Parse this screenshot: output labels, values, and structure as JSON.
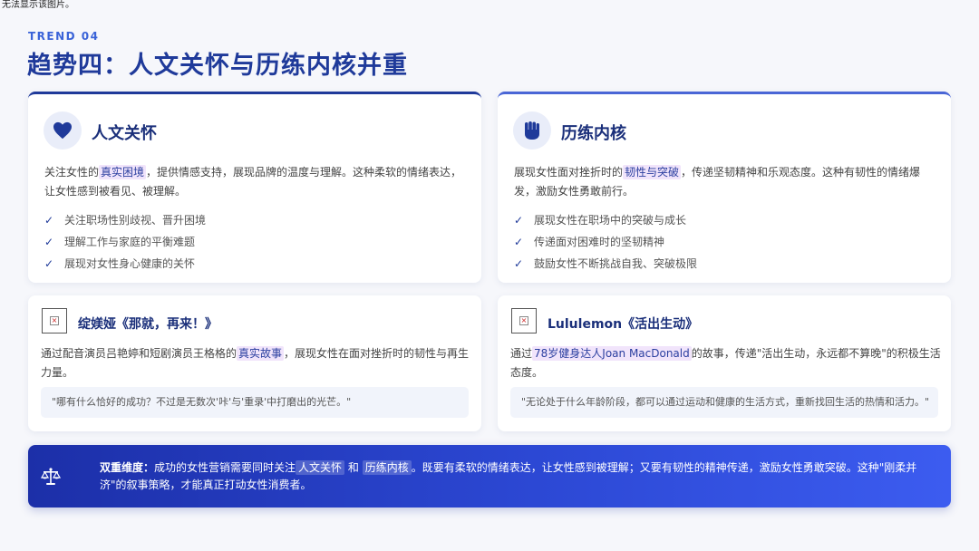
{
  "broken_image_alt": "无法显示该图片。",
  "header": {
    "trend": "TREND 04",
    "title": "趋势四：人文关怀与历练内核并重"
  },
  "cards": {
    "left": {
      "icon": "heart-icon",
      "title": "人文关怀",
      "desc_pre": "关注女性的",
      "desc_hl": "真实困境",
      "desc_post": "，提供情感支持，展现品牌的温度与理解。这种柔软的情绪表达，让女性感到被看见、被理解。",
      "items": [
        "关注职场性别歧视、晋升困境",
        "理解工作与家庭的平衡难题",
        "展现对女性身心健康的关怀"
      ]
    },
    "right": {
      "icon": "fist-icon",
      "title": "历练内核",
      "desc_pre": "展现女性面对挫折时的",
      "desc_hl": "韧性与突破",
      "desc_post": "，传递坚韧精神和乐观态度。这种有韧性的情绪爆发，激励女性勇敢前行。",
      "items": [
        "展现女性在职场中的突破与成长",
        "传递面对困难时的坚韧精神",
        "鼓励女性不断挑战自我、突破极限"
      ]
    }
  },
  "cases": {
    "left": {
      "title": "绽媄娅《那就，再来！》",
      "desc_pre": "通过配音演员吕艳婷和短剧演员王格格的",
      "desc_hl": "真实故事",
      "desc_post": "，展现女性在面对挫折时的韧性与再生力量。",
      "quote": "\"哪有什么恰好的成功？不过是无数次'咔'与'重录'中打磨出的光芒。\""
    },
    "right": {
      "title": "Lululemon《活出生动》",
      "desc_pre": "通过",
      "desc_hl": "78岁健身达人Joan MacDonald",
      "desc_post": "的故事，传递\"活出生动，永远都不算晚\"的积极生活态度。",
      "quote": "\"无论处于什么年龄阶段，都可以通过运动和健康的生活方式，重新找回生活的热情和活力。\""
    }
  },
  "banner": {
    "icon": "scale-icon",
    "label": "双重维度：",
    "text1": "成功的女性营销需要同时关注",
    "hl1": "人文关怀",
    "and": "和",
    "hl2": "历练内核",
    "text2": "。既要有柔软的情绪表达，让女性感到被理解；又要有韧性的精神传递，激励女性勇敢突破。这种\"刚柔并济\"的叙事策略，才能真正打动女性消费者。"
  },
  "colors": {
    "primary": "#1f3a9a",
    "accent": "#3a63d8",
    "highlight": "#f1e4fb",
    "banner_from": "#1c2fa8",
    "banner_to": "#3c5cf0"
  }
}
